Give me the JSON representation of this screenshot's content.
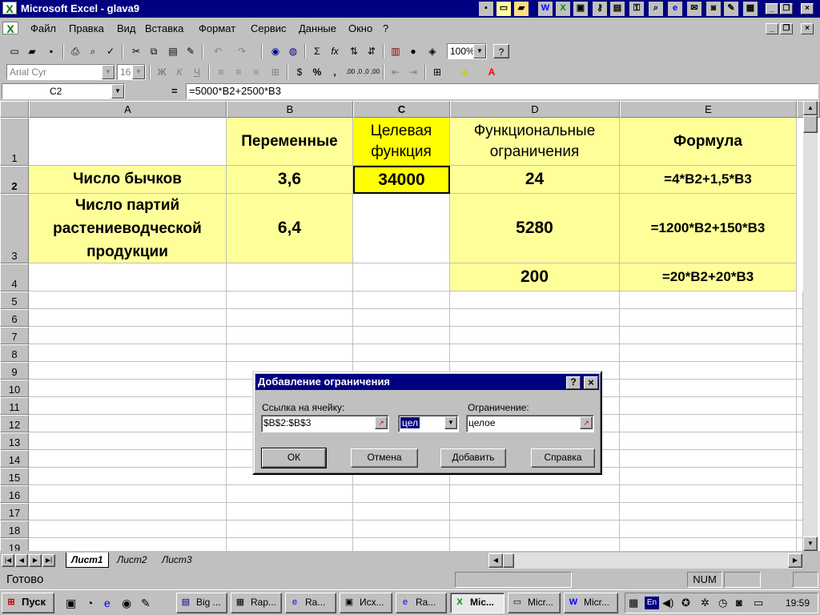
{
  "window": {
    "title": "Microsoft Excel - glava9"
  },
  "menu": [
    "Файл",
    "Правка",
    "Вид",
    "Вставка",
    "Формат",
    "Сервис",
    "Данные",
    "Окно",
    "?"
  ],
  "toolbar": {
    "zoom": "100%",
    "font": "Arial Cyr",
    "size": "16",
    "bold": "Ж",
    "italic": "К",
    "underline": "Ч",
    "percent": "%",
    "comma": ",",
    "dec_inc": ",00 ,0",
    "dec_dec": ",0 ,00",
    "sum": "Σ",
    "fx": "fx"
  },
  "formula_bar": {
    "cell_ref": "C2",
    "equals": "=",
    "formula": "=5000*B2+2500*B3"
  },
  "columns": [
    "A",
    "B",
    "C",
    "D",
    "E"
  ],
  "rows": [
    "1",
    "2",
    "3",
    "4",
    "5",
    "6",
    "7",
    "8",
    "9",
    "10",
    "11",
    "12",
    "13",
    "14",
    "15",
    "16",
    "17",
    "18",
    "19"
  ],
  "cells": {
    "B1": "Переменные",
    "C1": "Целевая функция",
    "D1": "Функциональные ограничения",
    "E1": "Формула",
    "A2": "Число бычков",
    "B2": "3,6",
    "C2": "34000",
    "D2": "24",
    "E2": "=4*B2+1,5*B3",
    "A3": "Число партий растениеводческой продукции",
    "B3": "6,4",
    "D3": "5280",
    "E3": "=1200*B2+150*B3",
    "D4": "200",
    "E4": "=20*B2+20*B3"
  },
  "dialog": {
    "title": "Добавление ограничения",
    "help": "?",
    "close": "×",
    "cell_ref_label": "Ссылка на ячейку:",
    "cell_ref_value": "$B$2:$B$3",
    "operator": "цел",
    "constraint_label": "Ограничение:",
    "constraint_value": "целое",
    "ok": "ОК",
    "cancel": "Отмена",
    "add": "Добавить",
    "help_btn": "Справка"
  },
  "sheets": [
    "Лист1",
    "Лист2",
    "Лист3"
  ],
  "status": {
    "ready": "Готово",
    "num": "NUM"
  },
  "taskbar": {
    "start": "Пуск",
    "tasks": [
      "Big ...",
      "Rap...",
      "Ra...",
      "Исх...",
      "Ra...",
      "Mic...",
      "Micr...",
      "Micr..."
    ],
    "lang": "En",
    "time": "19:59"
  },
  "colors": {
    "header_fill": "#ffff99",
    "selected_fill": "#ffff00",
    "title_bar": "#000080",
    "face": "#c0c0c0"
  }
}
